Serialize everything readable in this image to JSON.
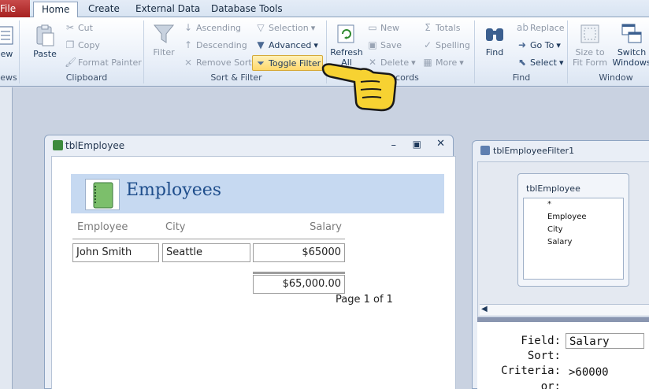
{
  "tabs": {
    "file": "File",
    "home": "Home",
    "create": "Create",
    "external": "External Data",
    "dbtools": "Database Tools"
  },
  "views": {
    "label": "iew",
    "group": "ews"
  },
  "clipboard": {
    "paste": "Paste",
    "cut": "Cut",
    "copy": "Copy",
    "format_painter": "Format Painter",
    "group": "Clipboard"
  },
  "sortfilter": {
    "filter": "Filter",
    "ascending": "Ascending",
    "descending": "Descending",
    "remove_sort": "Remove Sort",
    "selection": "Selection",
    "advanced": "Advanced",
    "toggle_filter": "Toggle Filter",
    "group": "Sort & Filter"
  },
  "records": {
    "refresh": "Refresh",
    "refresh2": "All",
    "new": "New",
    "save": "Save",
    "delete": "Delete",
    "totals": "Totals",
    "spelling": "Spelling",
    "more": "More",
    "group": "Records"
  },
  "find": {
    "find": "Find",
    "replace": "Replace",
    "goto": "Go To",
    "select": "Select",
    "group": "Find"
  },
  "window": {
    "size_fit": "Size to",
    "size_fit2": "Fit Form",
    "switch": "Switch",
    "switch2": "Windows",
    "group": "Window"
  },
  "report_window": {
    "title": "tblEmployee",
    "heading": "Employees",
    "col_employee": "Employee",
    "col_city": "City",
    "col_salary": "Salary",
    "row": {
      "employee": "John Smith",
      "city": "Seattle",
      "salary": "$65000"
    },
    "total": "$65,000.00",
    "page": "Page 1 of 1"
  },
  "query_window": {
    "title": "tblEmployeeFilter1",
    "table": "tblEmployee",
    "fields": [
      "*",
      "Employee",
      "City",
      "Salary"
    ],
    "grid": {
      "field_label": "Field:",
      "sort_label": "Sort:",
      "criteria_label": "Criteria:",
      "or_label": "or:",
      "field_value": "Salary",
      "criteria_value": ">60000"
    }
  },
  "colors": {
    "accent": "#1f4e8c",
    "file_tab": "#b83232",
    "highlight": "#ffd86b"
  }
}
